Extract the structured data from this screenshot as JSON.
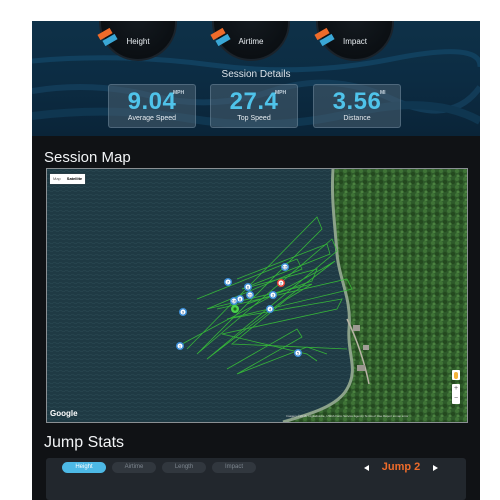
{
  "gauges": [
    {
      "label": "Height"
    },
    {
      "label": "Airtime"
    },
    {
      "label": "Impact"
    }
  ],
  "session": {
    "title": "Session Details",
    "stats": [
      {
        "value": "9.04",
        "unit": "MPH",
        "caption": "Average Speed"
      },
      {
        "value": "27.4",
        "unit": "MPH",
        "caption": "Top Speed"
      },
      {
        "value": "3.56",
        "unit": "MI",
        "caption": "Distance"
      }
    ]
  },
  "map": {
    "title": "Session Map",
    "map_types": [
      "Map",
      "Satellite"
    ],
    "active_map_type": "Satellite",
    "google_label": "Google",
    "attribution": "Imagery ©2015, DigitalGlobe, USDA Farm Service Agency   Terms of Use   Report a map error",
    "zoom_in": "+",
    "zoom_out": "−",
    "markers": [
      "1",
      "2",
      "3",
      "4",
      "5",
      "6",
      "7",
      "8",
      "9",
      "10",
      "11",
      "12"
    ],
    "highlight_marker": "2",
    "colors": {
      "track": "#38c238",
      "marker": "#3d8fd8",
      "highlight": "#e8463a",
      "start": "#4bd34b"
    }
  },
  "jump_stats": {
    "title": "Jump Stats",
    "tabs": [
      "Height",
      "Airtime",
      "Length",
      "Impact"
    ],
    "active_tab": "Height",
    "current_jump": "Jump 2"
  },
  "colors": {
    "accent": "#4fc3ea",
    "orange": "#ee6b2a",
    "panel": "#22272d"
  }
}
